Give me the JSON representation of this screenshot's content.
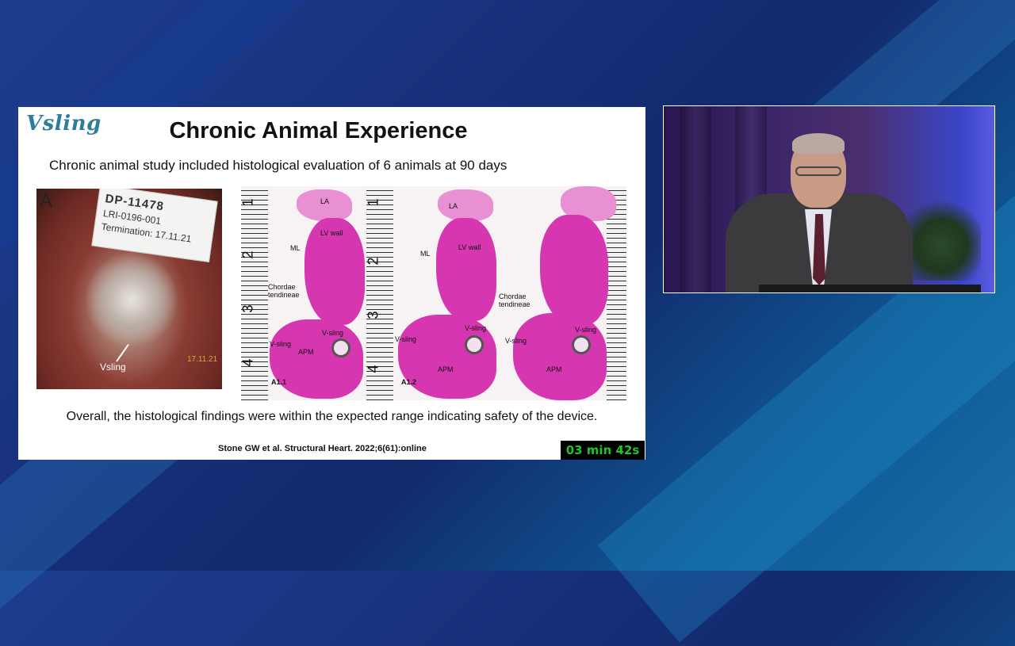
{
  "slide": {
    "logo": "Vsling",
    "title": "Chronic Animal Experience",
    "subtitle": "Chronic animal study included histological evaluation of 6 animals at 90 days",
    "conclusion": "Overall, the histological findings were within the expected range indicating safety of the device.",
    "citation": "Stone GW et al. Structural Heart. 2022;6(61):online"
  },
  "photo": {
    "panel_letter": "A",
    "tag_id": "DP-11478",
    "tag_line2": "LRI-0196-001",
    "tag_line3": "Termination: 17.11.21",
    "vsling_label": "Vsling",
    "date_stamp": "17.11.21"
  },
  "histology": {
    "ruler_numbers": [
      "1",
      "2",
      "3",
      "4"
    ],
    "panel1": {
      "la": "LA",
      "lv_wall": "LV wall",
      "ml": "ML",
      "chordae": "Chordae tendineae",
      "v_sling_a": "V-sling",
      "v_sling_b": "V-sling",
      "apm": "APM",
      "id": "A1.1"
    },
    "panel2": {
      "la": "LA",
      "lv_wall": "LV wall",
      "ml": "ML",
      "v_sling_a": "V-sling",
      "v_sling_b": "V-sling",
      "apm": "APM",
      "id": "A1.2"
    },
    "panel3": {
      "chordae": "Chordae tendineae",
      "v_sling_a": "V-sling",
      "v_sling_b": "V-sling",
      "apm": "APM"
    }
  },
  "timer": {
    "text": "03 min 42s"
  },
  "colors": {
    "timer_text": "#22c22a",
    "logo": "#2f7d9a",
    "stain": "#d637b0"
  }
}
